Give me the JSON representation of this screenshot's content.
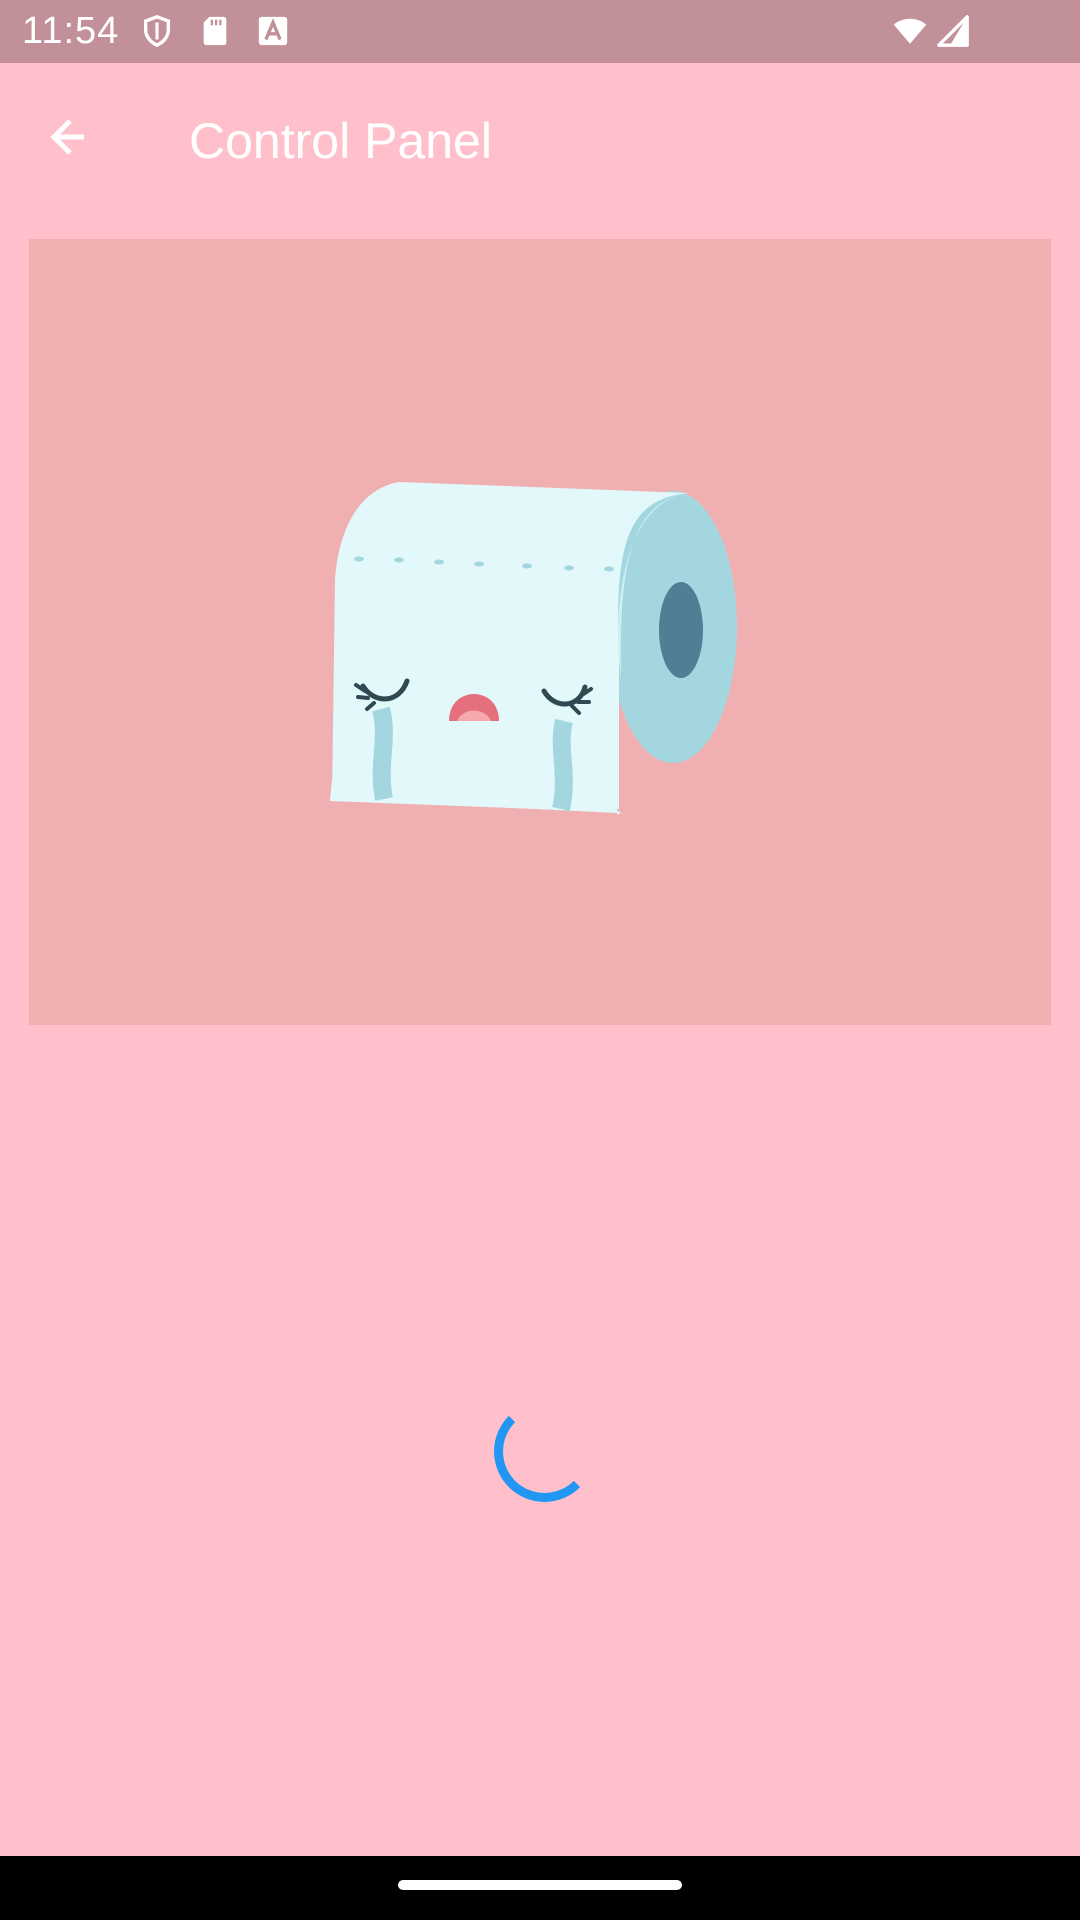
{
  "status_bar": {
    "time": "11:54",
    "icons": [
      "shield-icon",
      "sd-card-icon",
      "font-a-icon",
      "wifi-icon",
      "cell-signal-icon"
    ],
    "color": "#C29098"
  },
  "app_bar": {
    "title": "Control Panel",
    "back_icon": "arrow-back-icon"
  },
  "hero": {
    "image": "crying-toilet-paper-illustration",
    "background": "#F0B0B2"
  },
  "loading": {
    "indicator": "circular-spinner",
    "color": "#2196F3"
  },
  "theme": {
    "background": "#FFC0CB",
    "text": "#FFFFFF"
  }
}
